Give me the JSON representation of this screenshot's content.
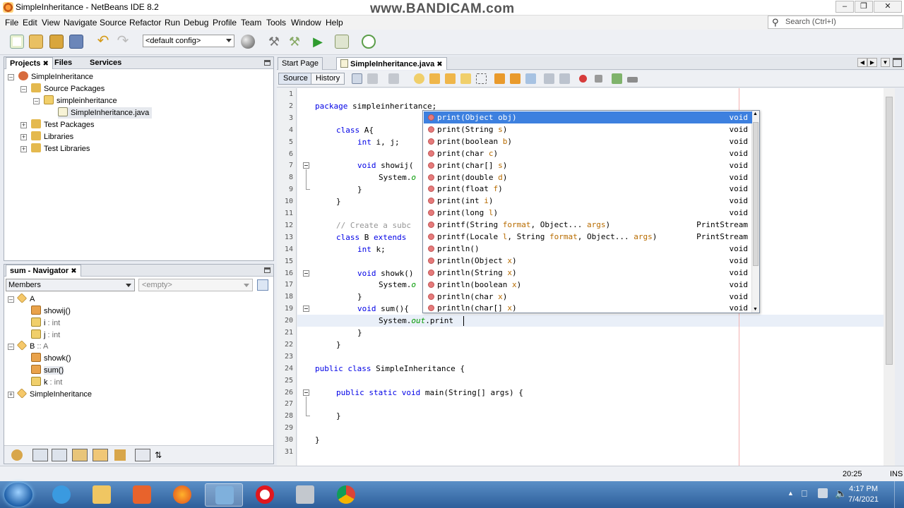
{
  "window": {
    "title": "SimpleInheritance - NetBeans IDE 8.2",
    "watermark": "www.BANDICAM.com"
  },
  "menu": [
    "File",
    "Edit",
    "View",
    "Navigate",
    "Source",
    "Refactor",
    "Run",
    "Debug",
    "Profile",
    "Team",
    "Tools",
    "Window",
    "Help"
  ],
  "search": {
    "placeholder": "Search (Ctrl+I)"
  },
  "toolbar": {
    "config": "<default config>"
  },
  "projects_panel": {
    "tabs": [
      "Projects",
      "Files",
      "Services"
    ],
    "tree": [
      "SimpleInheritance",
      "Source Packages",
      "simpleinheritance",
      "SimpleInheritance.java",
      "Test Packages",
      "Libraries",
      "Test Libraries"
    ]
  },
  "navigator": {
    "title": "sum - Navigator",
    "filter": "Members",
    "empty": "<empty>",
    "tree": [
      {
        "label": "A",
        "type": ""
      },
      {
        "label": "showij()",
        "type": ""
      },
      {
        "label": "i",
        "type": " : int"
      },
      {
        "label": "j",
        "type": " : int"
      },
      {
        "label": "B",
        "type": " :: A"
      },
      {
        "label": "showk()",
        "type": ""
      },
      {
        "label": "sum()",
        "type": ""
      },
      {
        "label": "k",
        "type": " : int"
      },
      {
        "label": "SimpleInheritance",
        "type": ""
      }
    ]
  },
  "editor": {
    "tabs": [
      "Start Page",
      "SimpleInheritance.java"
    ],
    "source_btn": "Source",
    "history_btn": "History",
    "line_numbers": [
      "1",
      "2",
      "3",
      "4",
      "5",
      "6",
      "7",
      "8",
      "9",
      "10",
      "11",
      "12",
      "13",
      "14",
      "15",
      "16",
      "17",
      "18",
      "19",
      "20",
      "21",
      "22",
      "23",
      "24",
      "25",
      "26",
      "27",
      "28",
      "29",
      "30",
      "31"
    ],
    "code": {
      "l2a": "package",
      "l2b": " simpleinheritance;",
      "l4a": "class",
      "l4b": " A{",
      "l5a": "int",
      "l5b": " i, j;",
      "l7a": "void",
      "l7b": " showij(",
      "l8a": "System.",
      "l8b": "o",
      "l9": "}",
      "l10": "}",
      "l12": "// Create a subc",
      "l13a": "class",
      "l13b": " B ",
      "l13c": "extends",
      "l14a": "int",
      "l14b": " k;",
      "l16a": "void",
      "l16b": " showk()",
      "l17a": "System.",
      "l17b": "o",
      "l18": "}",
      "l19a": "void",
      "l19b": " sum(){",
      "l20a": "System.",
      "l20b": "out",
      "l20c": ".print",
      "l21": "}",
      "l22": "}",
      "l24a": "public class",
      "l24b": " SimpleInheritance {",
      "l26a": "public static void",
      "l26b": " main(String[] args) {",
      "l28": "}",
      "l30": "}"
    }
  },
  "completion": [
    {
      "name": "print",
      "args": [
        [
          "Object ",
          "obj"
        ]
      ],
      "ret": "void"
    },
    {
      "name": "print",
      "args": [
        [
          "String ",
          "s"
        ]
      ],
      "ret": "void"
    },
    {
      "name": "print",
      "args": [
        [
          "boolean ",
          "b"
        ]
      ],
      "ret": "void"
    },
    {
      "name": "print",
      "args": [
        [
          "char ",
          "c"
        ]
      ],
      "ret": "void"
    },
    {
      "name": "print",
      "args": [
        [
          "char[] ",
          "s"
        ]
      ],
      "ret": "void"
    },
    {
      "name": "print",
      "args": [
        [
          "double ",
          "d"
        ]
      ],
      "ret": "void"
    },
    {
      "name": "print",
      "args": [
        [
          "float ",
          "f"
        ]
      ],
      "ret": "void"
    },
    {
      "name": "print",
      "args": [
        [
          "int ",
          "i"
        ]
      ],
      "ret": "void"
    },
    {
      "name": "print",
      "args": [
        [
          "long ",
          "l"
        ]
      ],
      "ret": "void"
    },
    {
      "name": "printf",
      "args": [
        [
          "String ",
          "format"
        ],
        [
          "Object... ",
          "args"
        ]
      ],
      "ret": "PrintStream"
    },
    {
      "name": "printf",
      "args": [
        [
          "Locale ",
          "l"
        ],
        [
          "String ",
          "format"
        ],
        [
          "Object... ",
          "args"
        ]
      ],
      "ret": "PrintStream"
    },
    {
      "name": "println",
      "args": [],
      "ret": "void"
    },
    {
      "name": "println",
      "args": [
        [
          "Object ",
          "x"
        ]
      ],
      "ret": "void"
    },
    {
      "name": "println",
      "args": [
        [
          "String ",
          "x"
        ]
      ],
      "ret": "void"
    },
    {
      "name": "println",
      "args": [
        [
          "boolean ",
          "x"
        ]
      ],
      "ret": "void"
    },
    {
      "name": "println",
      "args": [
        [
          "char ",
          "x"
        ]
      ],
      "ret": "void"
    },
    {
      "name": "println",
      "args": [
        [
          "char[] ",
          "x"
        ]
      ],
      "ret": "void"
    }
  ],
  "status": {
    "position": "20:25",
    "mode": "INS"
  },
  "clock": {
    "time": "4:17 PM",
    "date": "7/4/2021"
  }
}
